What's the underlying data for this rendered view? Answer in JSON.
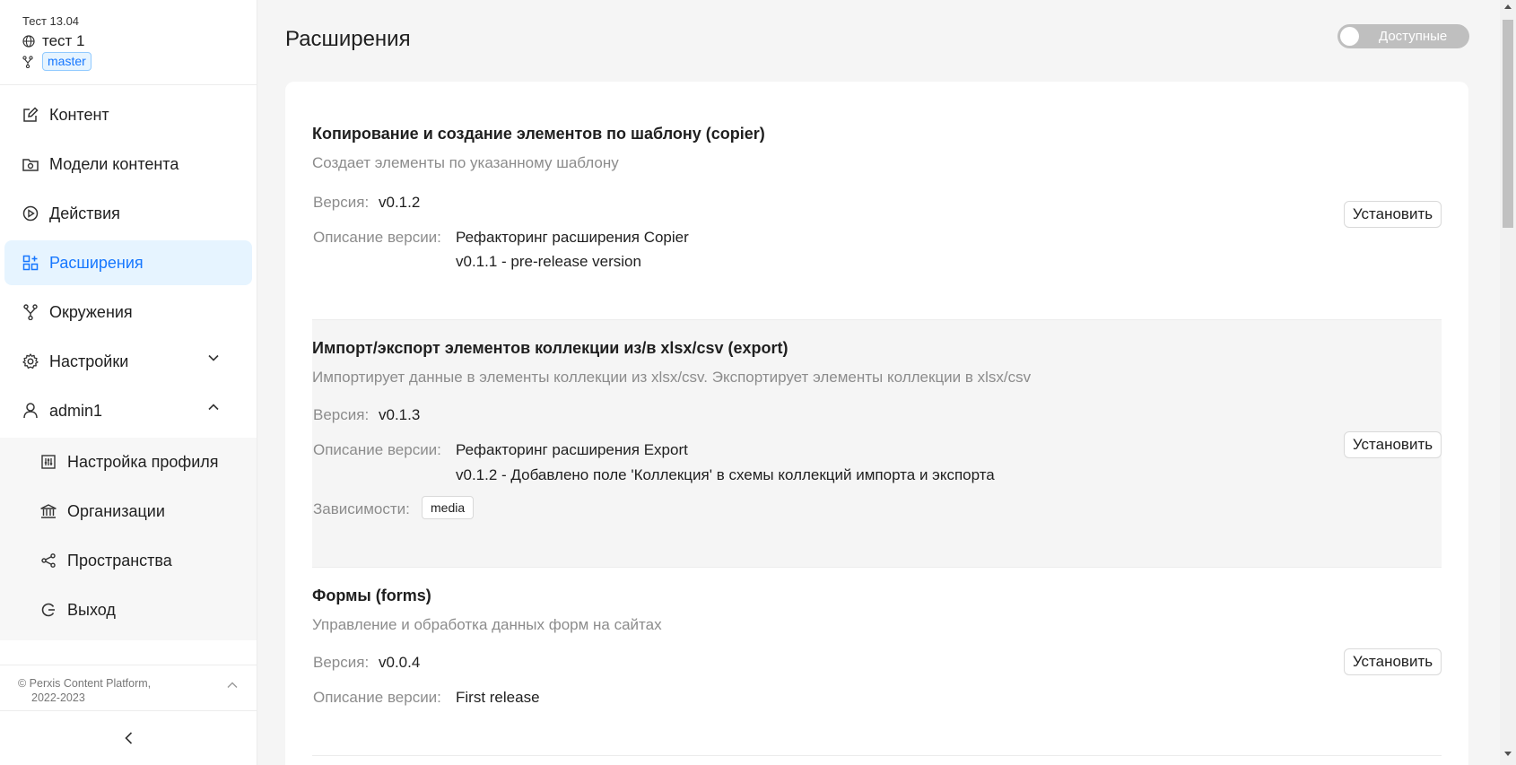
{
  "project": {
    "organization": "Тест 13.04",
    "space": "тест 1",
    "environment": "master"
  },
  "menu": {
    "content": "Контент",
    "models": "Модели контента",
    "actions": "Действия",
    "extensions": "Расширения",
    "environments": "Окружения",
    "settings": "Настройки",
    "user": "admin1",
    "profile": "Настройка профиля",
    "organizations": "Организации",
    "spaces": "Пространства",
    "logout": "Выход"
  },
  "footer": {
    "copyright_line1": "© Perxis Content Platform,",
    "copyright_line2": "2022-2023"
  },
  "page": {
    "title": "Расширения",
    "toggle_label": "Доступные"
  },
  "labels": {
    "version": "Версия:",
    "version_desc": "Описание версии:",
    "dependencies": "Зависимости:",
    "install": "Установить"
  },
  "extensions": [
    {
      "title": "Копирование и создание элементов по шаблону  (copier)",
      "description": "Создает элементы по указанному шаблону",
      "version": "v0.1.2",
      "version_desc": [
        "Рефакторинг расширения Copier",
        "v0.1.1 - pre-release version"
      ]
    },
    {
      "title": "Импорт/экспорт элементов коллекции из/в xlsx/csv  (export)",
      "description": "Импортирует данные в элементы коллекции из xlsx/csv. Экспортирует элементы коллекции в xlsx/csv",
      "version": "v0.1.3",
      "version_desc": [
        "Рефакторинг расширения Export",
        "v0.1.2 - Добавлено поле 'Коллекция' в схемы коллекций импорта и экспорта"
      ],
      "dependencies": [
        "media"
      ]
    },
    {
      "title": "Формы  (forms)",
      "description": "Управление и обработка данных форм на сайтах",
      "version": "v0.0.4",
      "version_desc": [
        "First release"
      ]
    }
  ],
  "colors": {
    "accent": "#1677ff",
    "active_bg": "#e6f4ff"
  }
}
